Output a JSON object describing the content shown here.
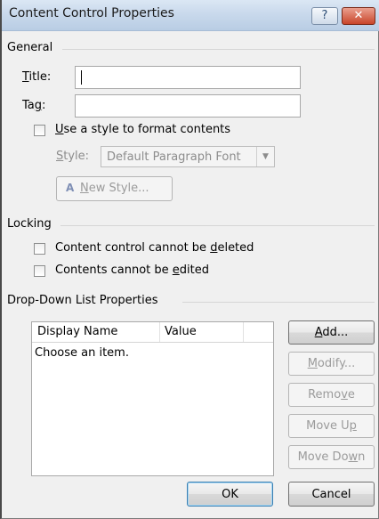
{
  "window": {
    "title": "Content Control Properties",
    "help_glyph": "?",
    "close_glyph": "✕"
  },
  "general": {
    "section_label": "General",
    "title_label": "Title:",
    "title_mnemonic": "T",
    "title_rest": "itle:",
    "title_value": "",
    "tag_label": "Tag:",
    "tag_pre": "Ta",
    "tag_mnemonic": "g",
    "tag_post": ":",
    "tag_value": "",
    "use_style_checkbox_checked": false,
    "use_style_mnemonic": "U",
    "use_style_rest": "se a style to format contents",
    "style_mnemonic": "S",
    "style_rest": "tyle:",
    "style_selected": "Default Paragraph Font",
    "new_style_mnemonic": "N",
    "new_style_rest": "ew Style..."
  },
  "locking": {
    "section_label": "Locking",
    "cannot_delete_checked": false,
    "cannot_delete_pre": "Content control cannot be ",
    "cannot_delete_mnemonic": "d",
    "cannot_delete_post": "eleted",
    "cannot_edit_checked": false,
    "cannot_edit_pre": "Contents cannot be ",
    "cannot_edit_mnemonic": "e",
    "cannot_edit_post": "dited"
  },
  "dropdown": {
    "section_label": "Drop-Down List Properties",
    "columns": [
      "Display Name",
      "Value"
    ],
    "rows": [
      {
        "display_name": "Choose an item.",
        "value": ""
      }
    ],
    "add_mnemonic": "A",
    "add_rest": "dd...",
    "modify_mnemonic": "M",
    "modify_rest": "odify...",
    "remove_pre": "Remo",
    "remove_mnemonic": "v",
    "remove_post": "e",
    "move_up_pre": "Move U",
    "move_up_mnemonic": "p",
    "move_down_pre": "Move Do",
    "move_down_mnemonic": "w",
    "move_down_post": "n"
  },
  "footer": {
    "ok_label": "OK",
    "cancel_label": "Cancel"
  }
}
